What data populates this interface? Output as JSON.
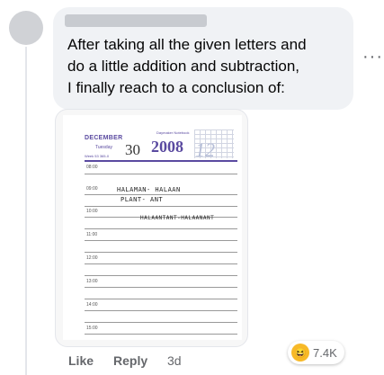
{
  "comment": {
    "body": "After taking all the given letters and\ndo a little addition and subtraction,\nI finally reach to a conclusion of:",
    "more_label": "···"
  },
  "planner": {
    "month": "DECEMBER",
    "weekday": "Tuesday",
    "week_info": "Week 53   365-0",
    "day": "30",
    "brand": "Daymaker Notebook",
    "year": "2008",
    "month_number": "12",
    "times": [
      "08:00",
      "09:00",
      "10:00",
      "11:00",
      "12:00",
      "13:00",
      "14:00",
      "15:00"
    ],
    "handwriting": {
      "line1": "HALAMAN- HALAAN",
      "line2": "PLANT- ANT",
      "line3": "HALAANTANT-HALAANANT"
    }
  },
  "actions": {
    "like": "Like",
    "reply": "Reply",
    "time_ago": "3d"
  },
  "reactions": {
    "icon": "haha-emoji-icon",
    "count": "7.4K",
    "color": "#f7b928"
  }
}
